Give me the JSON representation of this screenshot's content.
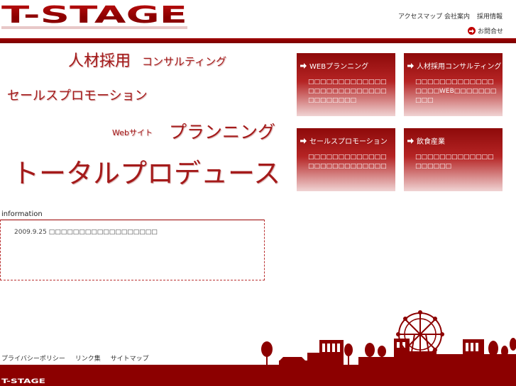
{
  "header": {
    "logo_text": "T-STAGE",
    "nav": [
      "アクセスマップ",
      "会社案内",
      "採用情報"
    ],
    "contact_label": "お問合せ"
  },
  "hero": {
    "line1a": "人材採用",
    "line1b": "コンサルティング",
    "line2": "セールスプロモーション",
    "line3a": "Webサイト",
    "line3b": "プランニング",
    "line4": "トータルプロデュース"
  },
  "cards": [
    {
      "title": "WEBプランニング",
      "body": "□□□□□□□□□□□□□□□□□□□□□□□□□□□□□□□□□□"
    },
    {
      "title": "人材採用コンサルティング",
      "body": "□□□□□□□□□□□□□□□□□WEB□□□□□□□□□□"
    },
    {
      "title": "セールスプロモーション",
      "body": "□□□□□□□□□□□□□□□□□□□□□□□□□□"
    },
    {
      "title": "飲食産業",
      "body": "□□□□□□□□□□□□□□□□□□□"
    }
  ],
  "information": {
    "title": "information",
    "date": "2009.9.25",
    "text": "□□□□□□□□□□□□□□□□□□"
  },
  "footer": {
    "links": [
      "プライバシーポリシー",
      "リンク集",
      "サイトマップ"
    ],
    "logo_text": "T-STAGE"
  },
  "colors": {
    "brand": "#a41a1a",
    "bar": "#8c0000"
  }
}
